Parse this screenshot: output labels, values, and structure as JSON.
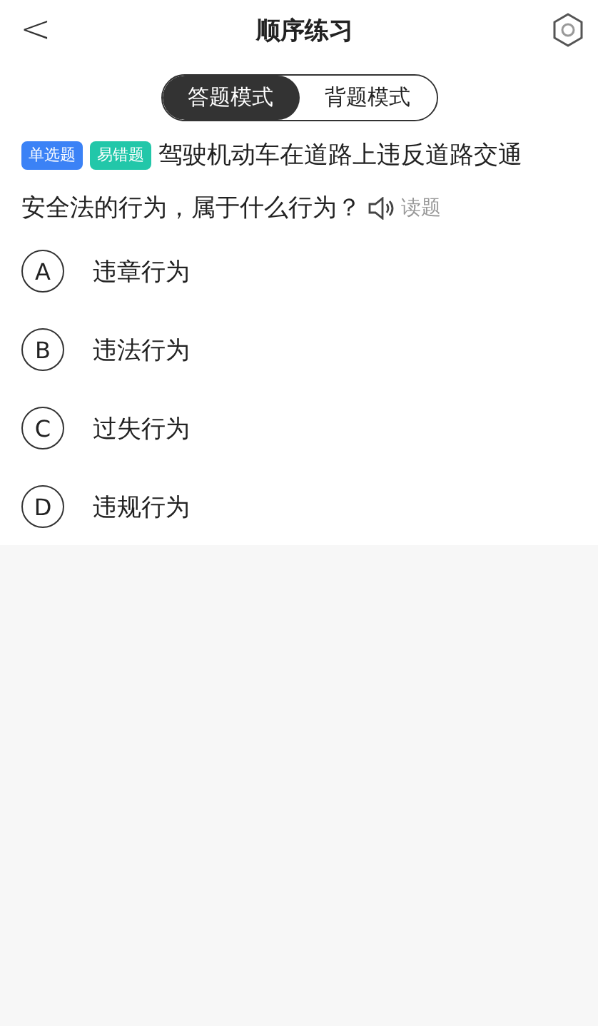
{
  "header": {
    "back": "<",
    "title": "顺序练习"
  },
  "modes": [
    {
      "label": "答题模式",
      "selected": true
    },
    {
      "label": "背题模式",
      "selected": false
    }
  ],
  "question": {
    "tags": [
      {
        "label": "单选题",
        "color": "#3b82f6"
      },
      {
        "label": "易错题",
        "color": "#22c7a9"
      }
    ],
    "text_lines": [
      "驾驶机动车在道路上违反道路交通",
      "安全法的行为，属于什么行为？"
    ],
    "read_label": "读题"
  },
  "options": [
    {
      "letter": "A",
      "text": "违章行为",
      "selected": false
    },
    {
      "letter": "B",
      "text": "违法行为",
      "selected": false
    },
    {
      "letter": "C",
      "text": "过失行为",
      "selected": false
    },
    {
      "letter": "D",
      "text": "违规行为",
      "selected": false
    }
  ]
}
